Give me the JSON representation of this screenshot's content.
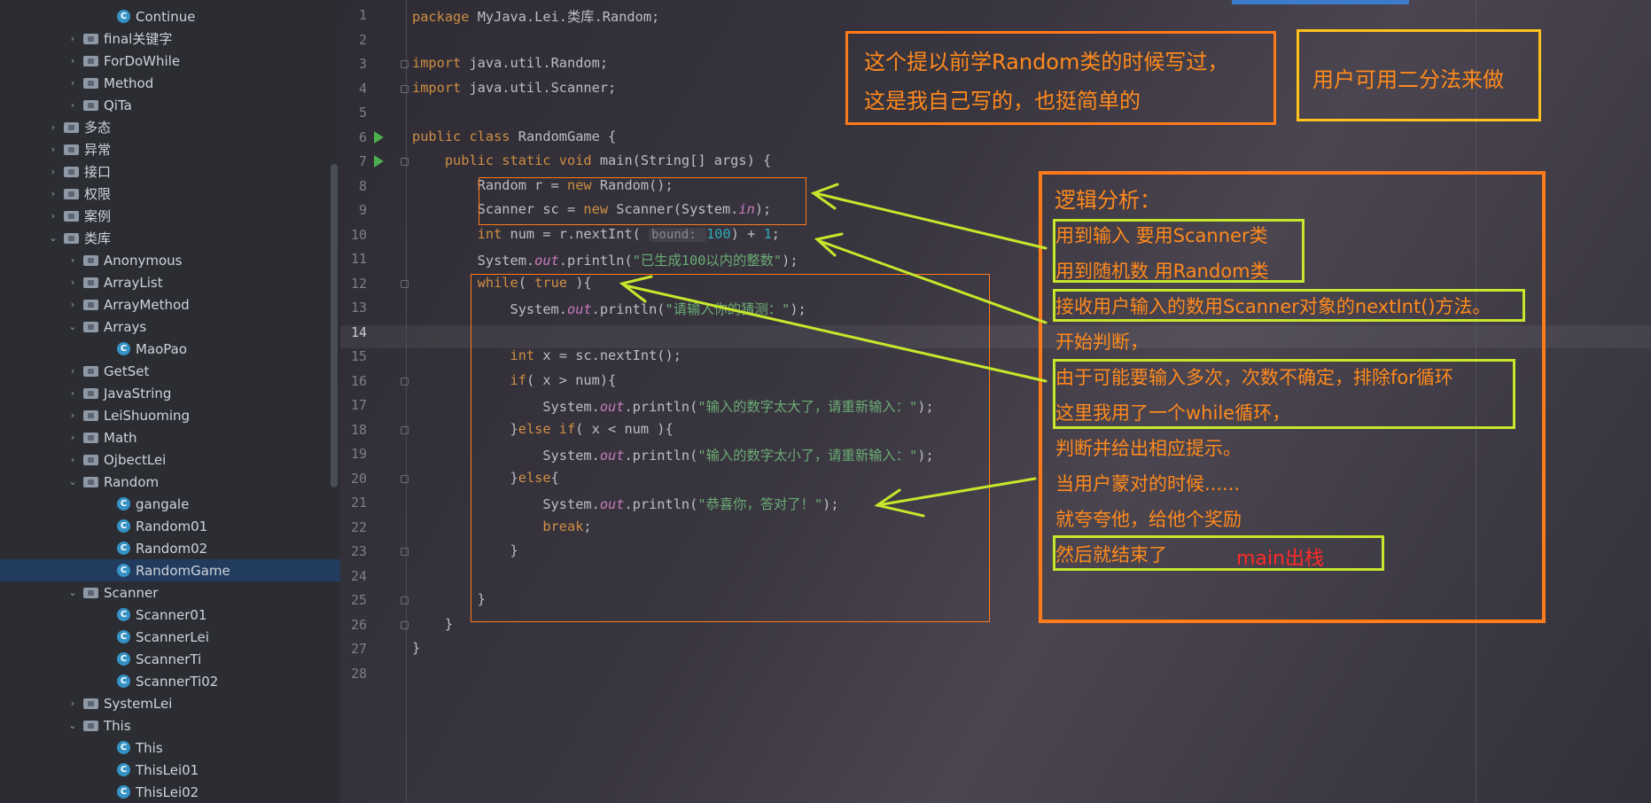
{
  "project_tree": {
    "items": [
      {
        "label": "Continue",
        "type": "class",
        "level": 3,
        "chevron": ""
      },
      {
        "label": "final关键字",
        "type": "package",
        "level": 2,
        "chevron": "›"
      },
      {
        "label": "ForDoWhile",
        "type": "package",
        "level": 2,
        "chevron": "›"
      },
      {
        "label": "Method",
        "type": "package",
        "level": 2,
        "chevron": "›"
      },
      {
        "label": "QiTa",
        "type": "package",
        "level": 2,
        "chevron": "›"
      },
      {
        "label": "多态",
        "type": "package",
        "level": 1,
        "chevron": "›"
      },
      {
        "label": "异常",
        "type": "package",
        "level": 1,
        "chevron": "›"
      },
      {
        "label": "接口",
        "type": "package",
        "level": 1,
        "chevron": "›"
      },
      {
        "label": "权限",
        "type": "package",
        "level": 1,
        "chevron": "›"
      },
      {
        "label": "案例",
        "type": "package",
        "level": 1,
        "chevron": "›"
      },
      {
        "label": "类库",
        "type": "package",
        "level": 1,
        "chevron": "⌄"
      },
      {
        "label": "Anonymous",
        "type": "package",
        "level": 2,
        "chevron": "›"
      },
      {
        "label": "ArrayList",
        "type": "package",
        "level": 2,
        "chevron": "›"
      },
      {
        "label": "ArrayMethod",
        "type": "package",
        "level": 2,
        "chevron": "›"
      },
      {
        "label": "Arrays",
        "type": "package",
        "level": 2,
        "chevron": "⌄"
      },
      {
        "label": "MaoPao",
        "type": "class",
        "level": 3,
        "chevron": ""
      },
      {
        "label": "GetSet",
        "type": "package",
        "level": 2,
        "chevron": "›"
      },
      {
        "label": "JavaString",
        "type": "package",
        "level": 2,
        "chevron": "›"
      },
      {
        "label": "LeiShuoming",
        "type": "package",
        "level": 2,
        "chevron": "›"
      },
      {
        "label": "Math",
        "type": "package",
        "level": 2,
        "chevron": "›"
      },
      {
        "label": "OjbectLei",
        "type": "package",
        "level": 2,
        "chevron": "›"
      },
      {
        "label": "Random",
        "type": "package",
        "level": 2,
        "chevron": "⌄"
      },
      {
        "label": "gangale",
        "type": "class",
        "level": 3,
        "chevron": ""
      },
      {
        "label": "Random01",
        "type": "class",
        "level": 3,
        "chevron": ""
      },
      {
        "label": "Random02",
        "type": "class",
        "level": 3,
        "chevron": ""
      },
      {
        "label": "RandomGame",
        "type": "class",
        "level": 3,
        "chevron": "",
        "selected": true
      },
      {
        "label": "Scanner",
        "type": "package",
        "level": 2,
        "chevron": "⌄"
      },
      {
        "label": "Scanner01",
        "type": "class",
        "level": 3,
        "chevron": ""
      },
      {
        "label": "ScannerLei",
        "type": "class",
        "level": 3,
        "chevron": ""
      },
      {
        "label": "ScannerTi",
        "type": "class",
        "level": 3,
        "chevron": ""
      },
      {
        "label": "ScannerTi02",
        "type": "class",
        "level": 3,
        "chevron": ""
      },
      {
        "label": "SystemLei",
        "type": "package",
        "level": 2,
        "chevron": "›"
      },
      {
        "label": "This",
        "type": "package",
        "level": 2,
        "chevron": "⌄"
      },
      {
        "label": "This",
        "type": "class",
        "level": 3,
        "chevron": ""
      },
      {
        "label": "ThisLei01",
        "type": "class",
        "level": 3,
        "chevron": ""
      },
      {
        "label": "ThisLei02",
        "type": "class",
        "level": 3,
        "chevron": ""
      }
    ]
  },
  "editor": {
    "current_line": 14,
    "lines": [
      [
        {
          "t": "package ",
          "c": "kw"
        },
        {
          "t": "MyJava.Lei.类库.Random;",
          "c": ""
        }
      ],
      [],
      [
        {
          "t": "import ",
          "c": "kw"
        },
        {
          "t": "java.util.Random;",
          "c": ""
        }
      ],
      [
        {
          "t": "import ",
          "c": "kw"
        },
        {
          "t": "java.util.Scanner;",
          "c": ""
        }
      ],
      [],
      [
        {
          "t": "public class ",
          "c": "kw"
        },
        {
          "t": "RandomGame {",
          "c": ""
        }
      ],
      [
        {
          "t": "    public static void ",
          "c": "kw"
        },
        {
          "t": "main(String[] args) {",
          "c": ""
        }
      ],
      [
        {
          "t": "        Random r = ",
          "c": ""
        },
        {
          "t": "new ",
          "c": "kw"
        },
        {
          "t": "Random();",
          "c": ""
        }
      ],
      [
        {
          "t": "        Scanner sc = ",
          "c": ""
        },
        {
          "t": "new ",
          "c": "kw"
        },
        {
          "t": "Scanner(System.",
          "c": ""
        },
        {
          "t": "in",
          "c": "fld"
        },
        {
          "t": ");",
          "c": ""
        }
      ],
      [
        {
          "t": "        int ",
          "c": "kw"
        },
        {
          "t": "num = r.nextInt( ",
          "c": ""
        },
        {
          "t": "bound: ",
          "c": "hint"
        },
        {
          "t": "100",
          "c": "num"
        },
        {
          "t": ") + ",
          "c": ""
        },
        {
          "t": "1",
          "c": "num"
        },
        {
          "t": ";",
          "c": ""
        }
      ],
      [
        {
          "t": "        System.",
          "c": ""
        },
        {
          "t": "out",
          "c": "fld"
        },
        {
          "t": ".println(",
          "c": ""
        },
        {
          "t": "\"已生成100以内的整数\"",
          "c": "str"
        },
        {
          "t": ");",
          "c": ""
        }
      ],
      [
        {
          "t": "        while",
          "c": "kw"
        },
        {
          "t": "( ",
          "c": ""
        },
        {
          "t": "true",
          "c": "kw"
        },
        {
          "t": " ){",
          "c": ""
        }
      ],
      [
        {
          "t": "            System.",
          "c": ""
        },
        {
          "t": "out",
          "c": "fld"
        },
        {
          "t": ".println(",
          "c": ""
        },
        {
          "t": "\"请输入你的猜测：\"",
          "c": "str"
        },
        {
          "t": ");",
          "c": ""
        }
      ],
      [],
      [
        {
          "t": "            int ",
          "c": "kw"
        },
        {
          "t": "x = sc.nextInt();",
          "c": ""
        }
      ],
      [
        {
          "t": "            if",
          "c": "kw"
        },
        {
          "t": "( x > num){",
          "c": ""
        }
      ],
      [
        {
          "t": "                System.",
          "c": ""
        },
        {
          "t": "out",
          "c": "fld"
        },
        {
          "t": ".println(",
          "c": ""
        },
        {
          "t": "\"输入的数字太大了，请重新输入：\"",
          "c": "str"
        },
        {
          "t": ");",
          "c": ""
        }
      ],
      [
        {
          "t": "            }",
          "c": ""
        },
        {
          "t": "else if",
          "c": "kw"
        },
        {
          "t": "( x < num ){",
          "c": ""
        }
      ],
      [
        {
          "t": "                System.",
          "c": ""
        },
        {
          "t": "out",
          "c": "fld"
        },
        {
          "t": ".println(",
          "c": ""
        },
        {
          "t": "\"输入的数字太小了，请重新输入：\"",
          "c": "str"
        },
        {
          "t": ");",
          "c": ""
        }
      ],
      [
        {
          "t": "            }",
          "c": ""
        },
        {
          "t": "else",
          "c": "kw"
        },
        {
          "t": "{",
          "c": ""
        }
      ],
      [
        {
          "t": "                System.",
          "c": ""
        },
        {
          "t": "out",
          "c": "fld"
        },
        {
          "t": ".println(",
          "c": ""
        },
        {
          "t": "\"恭喜你，答对了！\"",
          "c": "str"
        },
        {
          "t": ");",
          "c": ""
        }
      ],
      [
        {
          "t": "                break",
          "c": "kw"
        },
        {
          "t": ";",
          "c": ""
        }
      ],
      [
        {
          "t": "            }",
          "c": ""
        }
      ],
      [],
      [
        {
          "t": "        }",
          "c": ""
        }
      ],
      [
        {
          "t": "    }",
          "c": ""
        }
      ],
      [
        {
          "t": "}",
          "c": ""
        }
      ],
      []
    ]
  },
  "annotations": {
    "note_top_left": [
      "这个提以前学Random类的时候写过，",
      "这是我自己写的，也挺简单的"
    ],
    "note_top_right": "用户可用二分法来做",
    "analysis_title": "逻辑分析：",
    "analysis_lines": [
      "用到输入 要用Scanner类",
      "用到随机数 用Random类",
      "接收用户输入的数用Scanner对象的nextInt()方法。",
      "开始判断，",
      "由于可能要输入多次，次数不确定，排除for循环",
      "这里我用了一个while循环，",
      "判断并给出相应提示。",
      "当用户蒙对的时候......",
      "就夸夸他，给他个奖励",
      "然后就结束了"
    ],
    "main_pop": "main出栈",
    "colors": {
      "orange": "#ff7a1a",
      "yellow": "#ffc21a",
      "green": "#c6e72b",
      "red": "#ff2a2a"
    }
  }
}
